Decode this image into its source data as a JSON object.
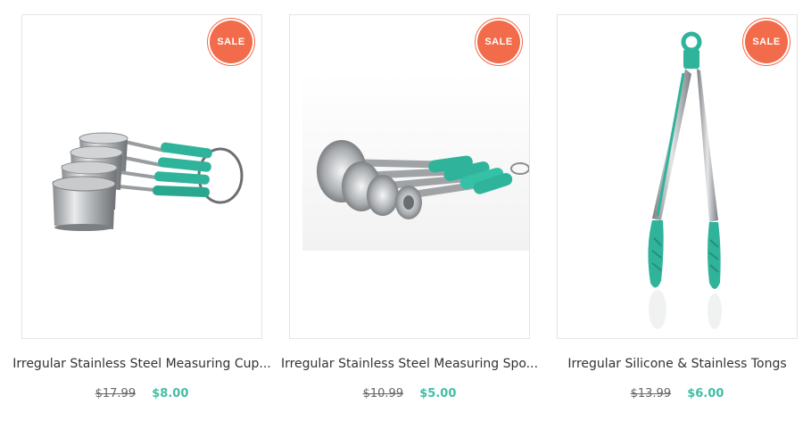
{
  "badge_label": "SALE",
  "colors": {
    "sale_badge": "#f26b4a",
    "new_price": "#3fbfa4",
    "teal_handle": "#2fb39b"
  },
  "products": [
    {
      "name": "Irregular Stainless Steel Measuring Cup...",
      "old_price": "$17.99",
      "new_price": "$8.00",
      "image": "measuring-cups-image"
    },
    {
      "name": "Irregular Stainless Steel Measuring Spo...",
      "old_price": "$10.99",
      "new_price": "$5.00",
      "image": "measuring-spoons-image"
    },
    {
      "name": "Irregular Silicone & Stainless Tongs",
      "old_price": "$13.99",
      "new_price": "$6.00",
      "image": "tongs-image"
    }
  ]
}
